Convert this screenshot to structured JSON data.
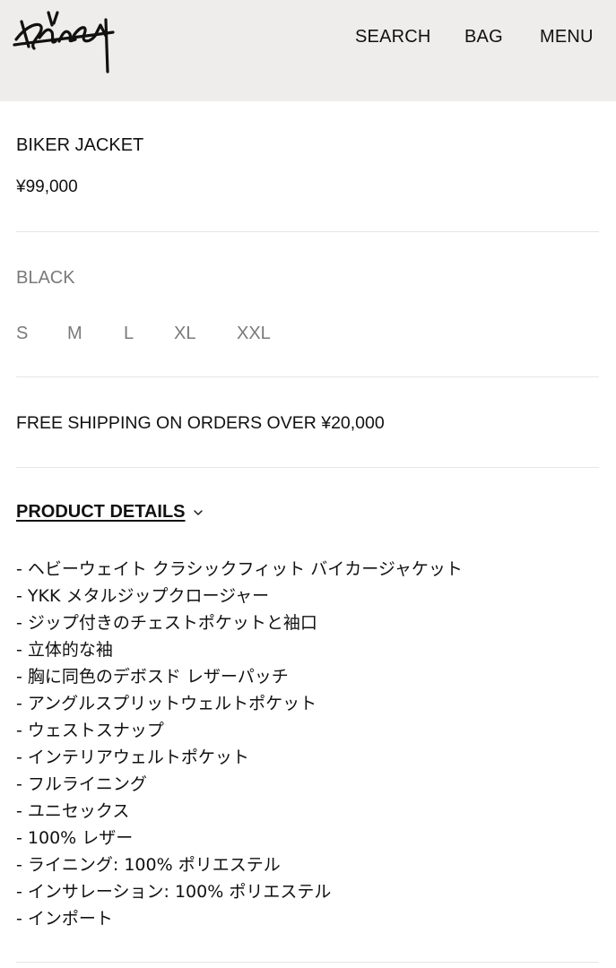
{
  "header": {
    "logo_alt": "Stüssy",
    "nav": {
      "search": "SEARCH",
      "bag": "BAG",
      "menu": "MENU"
    }
  },
  "product": {
    "title": "BIKER JACKET",
    "price": "¥99,000",
    "color": "BLACK",
    "sizes": [
      "S",
      "M",
      "L",
      "XL",
      "XXL"
    ]
  },
  "shipping": "FREE SHIPPING ON ORDERS OVER ¥20,000",
  "details": {
    "toggle_label": "PRODUCT DETAILS",
    "items": [
      "- ヘビーウェイト クラシックフィット バイカージャケット",
      "- YKK メタルジップクロージャー",
      "- ジップ付きのチェストポケットと袖口",
      "- 立体的な袖",
      "- 胸に同色のデボスド レザーパッチ",
      "- アングルスプリットウェルトポケット",
      "- ウェストスナップ",
      "- インテリアウェルトポケット",
      "- フルライニング",
      "- ユニセックス",
      "- 100% レザー",
      "- ライニング: 100% ポリエステル",
      "- インサレーション: 100% ポリエステル",
      "- インポート"
    ]
  },
  "colors": {
    "header_bg": "#eeedeb",
    "muted_text": "#7a7a7a",
    "divider": "#e6e6e6"
  }
}
